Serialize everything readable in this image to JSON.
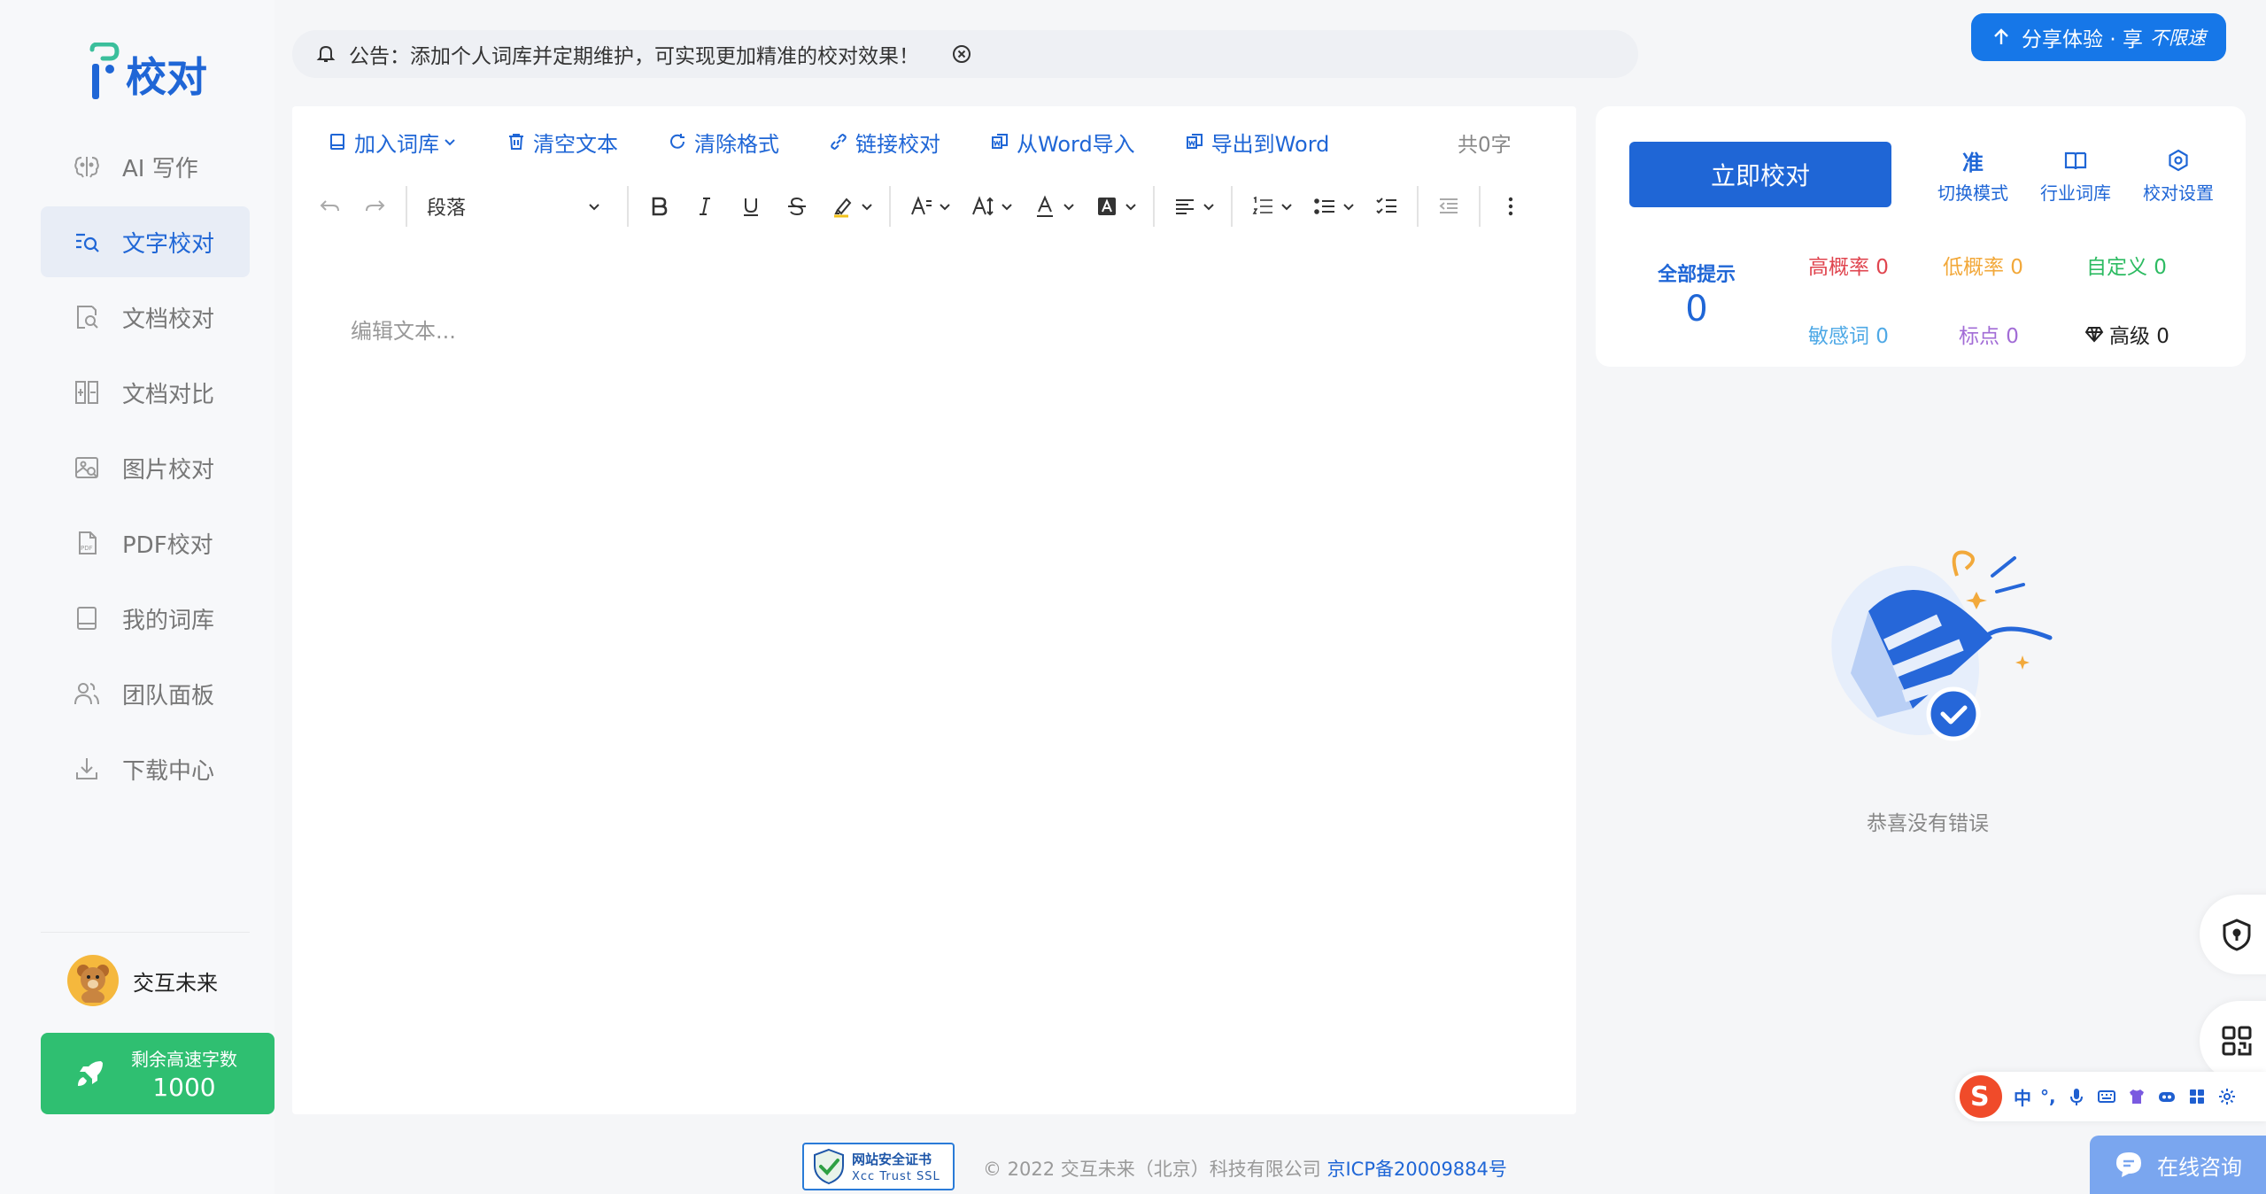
{
  "logo": {
    "text": "校对"
  },
  "sidebar": {
    "items": [
      {
        "label": "AI 写作",
        "icon": "brain-icon",
        "active": false
      },
      {
        "label": "文字校对",
        "icon": "text-search-icon",
        "active": true
      },
      {
        "label": "文档校对",
        "icon": "doc-search-icon",
        "active": false
      },
      {
        "label": "文档对比",
        "icon": "doc-compare-icon",
        "active": false
      },
      {
        "label": "图片校对",
        "icon": "image-search-icon",
        "active": false
      },
      {
        "label": "PDF校对",
        "icon": "pdf-icon",
        "active": false
      },
      {
        "label": "我的词库",
        "icon": "book-icon",
        "active": false
      },
      {
        "label": "团队面板",
        "icon": "team-icon",
        "active": false
      },
      {
        "label": "下载中心",
        "icon": "download-icon",
        "active": false
      }
    ],
    "user": {
      "name": "交互未来"
    },
    "quota": {
      "label": "剩余高速字数",
      "value": "1000"
    }
  },
  "notice": {
    "text": "公告：添加个人词库并定期维护，可实现更加精准的校对效果！"
  },
  "share": {
    "label": "分享体验 · 享",
    "emphasis": "不限速"
  },
  "editor": {
    "toolbar": {
      "add_lexicon": "加入词库",
      "clear_text": "清空文本",
      "clear_format": "清除格式",
      "link_check": "链接校对",
      "import_word": "从Word导入",
      "export_word": "导出到Word"
    },
    "word_count": "共0字",
    "paragraph_select": "段落",
    "placeholder": "编辑文本..."
  },
  "panel": {
    "check_button": "立即校对",
    "tools": [
      {
        "glyph": "准",
        "label": "切换模式"
      },
      {
        "glyph": "",
        "label": "行业词库"
      },
      {
        "glyph": "",
        "label": "校对设置"
      }
    ],
    "total": {
      "label": "全部提示",
      "value": "0"
    },
    "stats": {
      "high": "高概率 0",
      "low": "低概率 0",
      "custom": "自定义 0",
      "sensitive": "敏感词 0",
      "punct": "标点 0",
      "advanced": "高级 0"
    },
    "colors": {
      "high": "#e0454f",
      "low": "#f2a83a",
      "custom": "#2dbb62",
      "sensitive": "#4fa9e6",
      "punct": "#a26cd6",
      "advanced": "#222222"
    }
  },
  "result": {
    "text": "恭喜没有错误"
  },
  "ime": {
    "items": [
      "中",
      "°,"
    ]
  },
  "consult": {
    "label": "在线咨询"
  },
  "footer": {
    "ssl_title": "网站安全证书",
    "ssl_sub": "Xcc Trust SSL",
    "copyright": "© 2022 交互未来（北京）科技有限公司",
    "icp": "京ICP备20009884号"
  },
  "accent": "#1f66d6"
}
